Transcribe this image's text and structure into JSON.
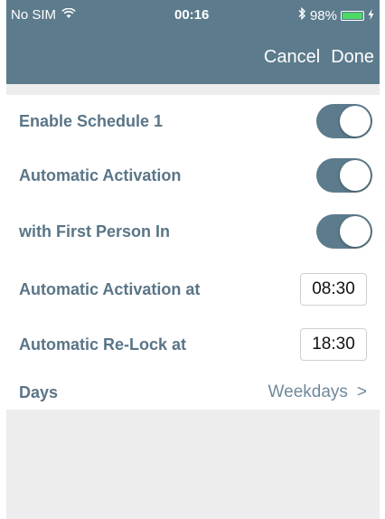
{
  "status": {
    "carrier": "No SIM",
    "time": "00:16",
    "battery": "98%",
    "wifi_icon": "wifi-icon",
    "bluetooth_icon": "bluetooth-icon",
    "charging_icon": "charging-bolt-icon"
  },
  "nav": {
    "cancel_label": "Cancel",
    "done_label": "Done"
  },
  "settings": {
    "enable_schedule": {
      "label": "Enable Schedule 1",
      "on": true
    },
    "automatic_activation": {
      "label": "Automatic Activation",
      "on": true
    },
    "first_person_in": {
      "label": "with First Person In",
      "on": true
    },
    "activation_at": {
      "label": "Automatic Activation at",
      "value": "08:30"
    },
    "relock_at": {
      "label": "Automatic Re-Lock at",
      "value": "18:30"
    },
    "days": {
      "label": "Days",
      "value": "Weekdays",
      "chevron": ">"
    }
  },
  "colors": {
    "accent": "#5c7b8d",
    "label": "#5a7587",
    "background": "#ededed",
    "battery_fill": "#4cd964"
  }
}
